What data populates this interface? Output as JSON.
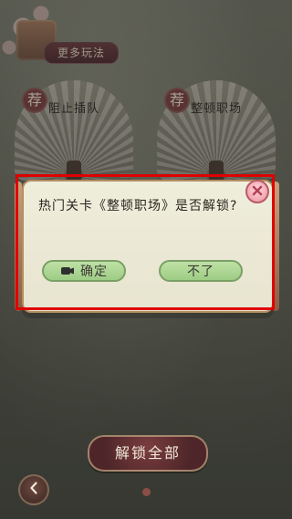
{
  "top": {
    "more_label": "更多玩法"
  },
  "fans": [
    {
      "badge": "荐",
      "title": "阻止插队"
    },
    {
      "badge": "荐",
      "title": "整顿职场"
    }
  ],
  "dialog": {
    "message": "热门关卡《整顿职场》是否解锁?",
    "confirm_label": "确定",
    "cancel_label": "不了",
    "icons": {
      "close": "close-icon",
      "video": "video-icon"
    }
  },
  "bottom": {
    "unlock_all_label": "解锁全部"
  },
  "colors": {
    "highlight": "#e00000",
    "dialog_bg": "#efeedc",
    "button_green": "#a9d890",
    "close_pink": "#f0a6b2"
  }
}
